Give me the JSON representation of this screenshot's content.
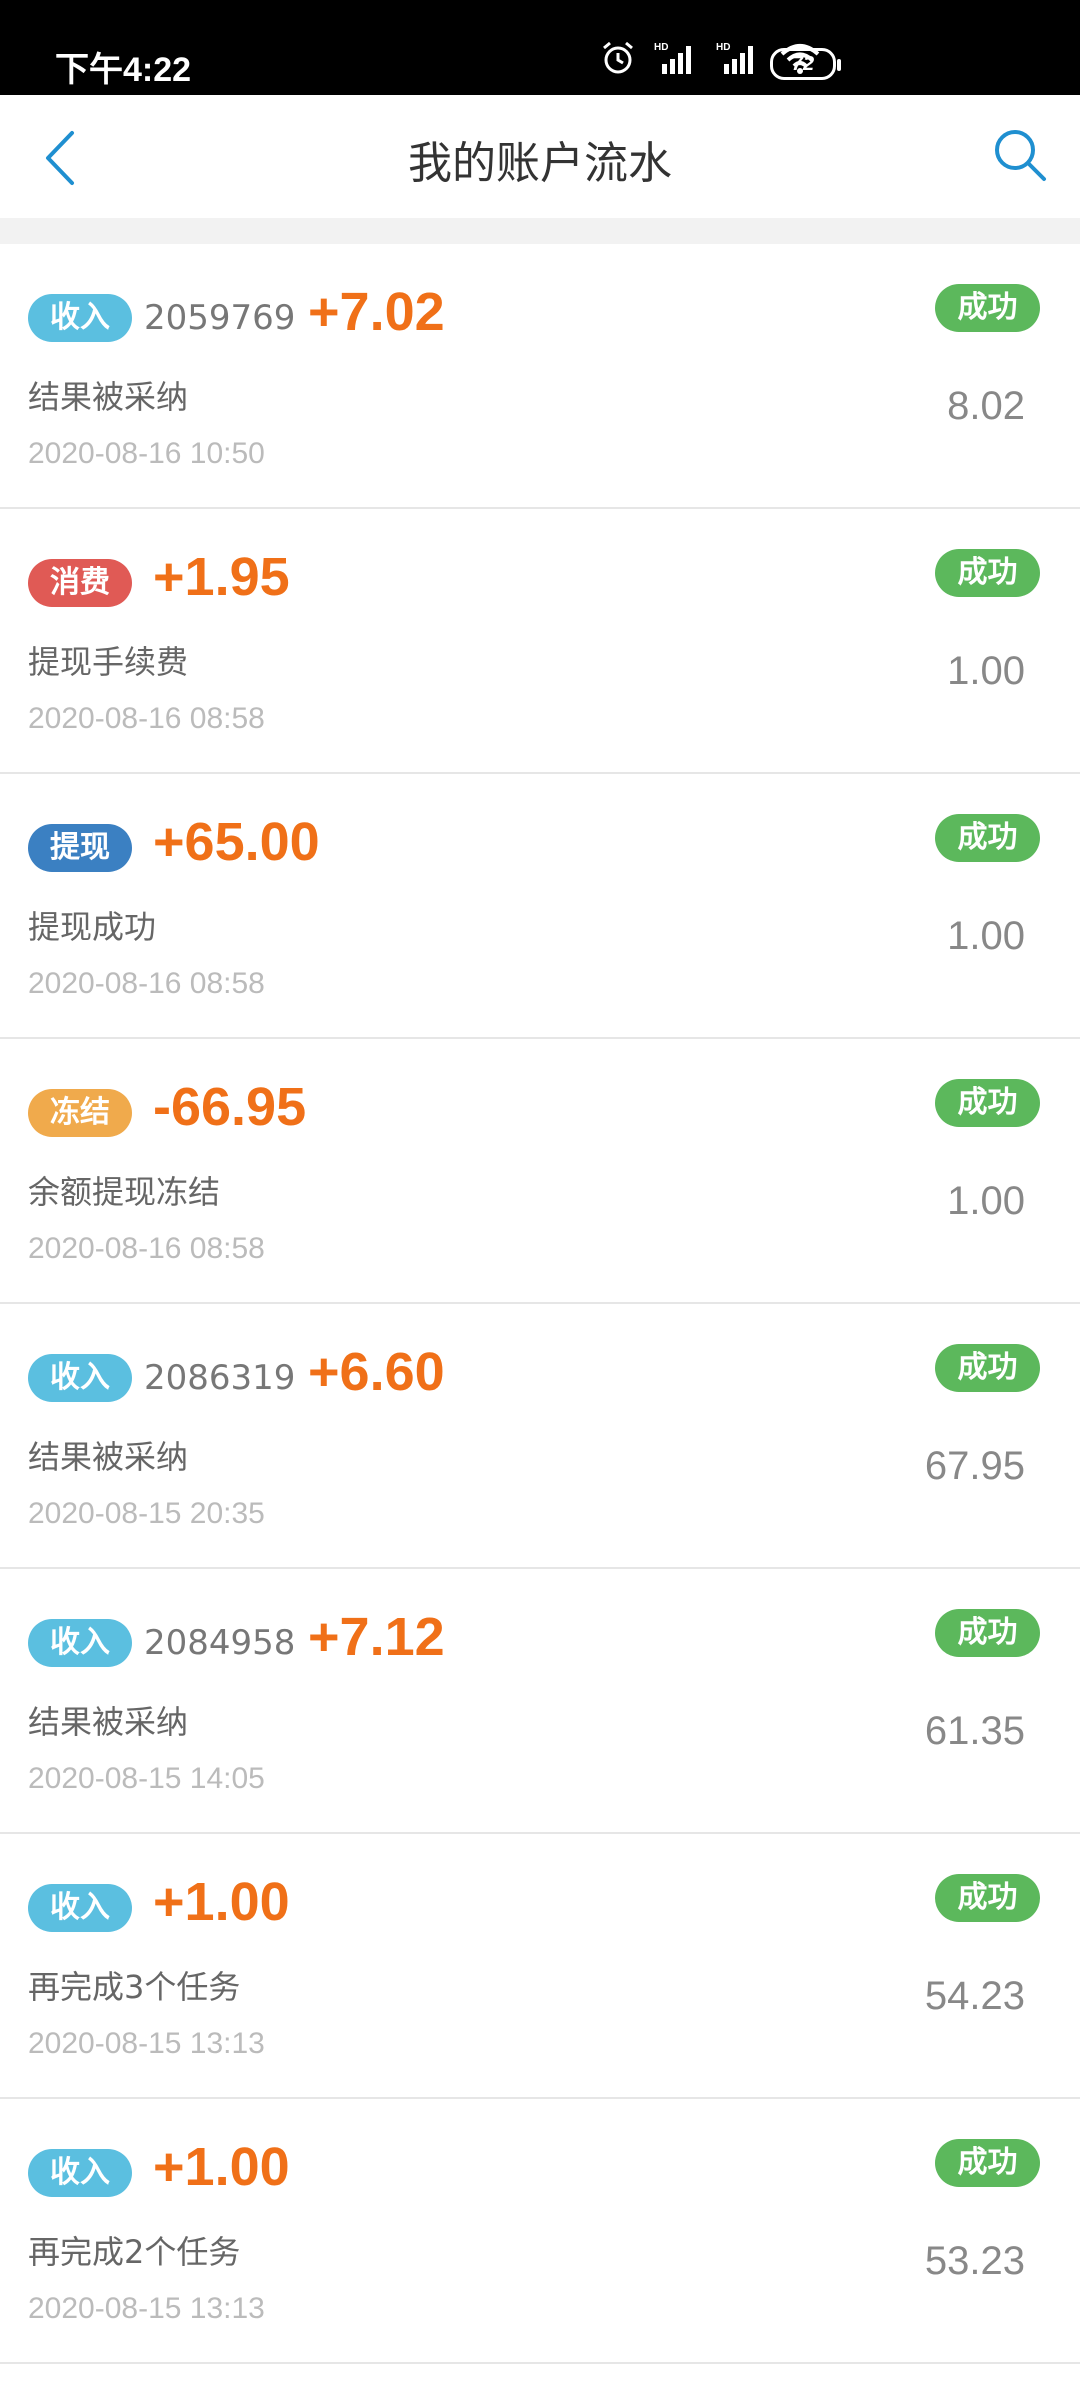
{
  "status_bar": {
    "time": "下午4:22",
    "battery": "72",
    "icons": [
      "alarm-icon",
      "hd-signal-icon",
      "hd-signal-icon",
      "wifi-icon",
      "battery-icon"
    ]
  },
  "nav": {
    "title": "我的账户流水",
    "back_icon": "chevron-left-icon",
    "search_icon": "search-icon"
  },
  "colors": {
    "accent": "#1f8fd0",
    "amount": "#f07018",
    "success": "#5cb85c",
    "tag_income": "#5bbfe0",
    "tag_consume": "#e05a55",
    "tag_withdraw": "#3b80c2",
    "tag_freeze": "#f0aa4c"
  },
  "transactions": [
    {
      "tag": "收入",
      "id": "2059769",
      "amount": "+7.02",
      "status": "成功",
      "desc": "结果被采纳",
      "time": "2020-08-16 10:50",
      "balance": "8.02"
    },
    {
      "tag": "消费",
      "id": "",
      "amount": "+1.95",
      "status": "成功",
      "desc": "提现手续费",
      "time": "2020-08-16 08:58",
      "balance": "1.00"
    },
    {
      "tag": "提现",
      "id": "",
      "amount": "+65.00",
      "status": "成功",
      "desc": "提现成功",
      "time": "2020-08-16 08:58",
      "balance": "1.00"
    },
    {
      "tag": "冻结",
      "id": "",
      "amount": "-66.95",
      "status": "成功",
      "desc": "余额提现冻结",
      "time": "2020-08-16 08:58",
      "balance": "1.00"
    },
    {
      "tag": "收入",
      "id": "2086319",
      "amount": "+6.60",
      "status": "成功",
      "desc": "结果被采纳",
      "time": "2020-08-15 20:35",
      "balance": "67.95"
    },
    {
      "tag": "收入",
      "id": "2084958",
      "amount": "+7.12",
      "status": "成功",
      "desc": "结果被采纳",
      "time": "2020-08-15 14:05",
      "balance": "61.35"
    },
    {
      "tag": "收入",
      "id": "",
      "amount": "+1.00",
      "status": "成功",
      "desc": "再完成3个任务",
      "time": "2020-08-15 13:13",
      "balance": "54.23"
    },
    {
      "tag": "收入",
      "id": "",
      "amount": "+1.00",
      "status": "成功",
      "desc": "再完成2个任务",
      "time": "2020-08-15 13:13",
      "balance": "53.23"
    }
  ]
}
